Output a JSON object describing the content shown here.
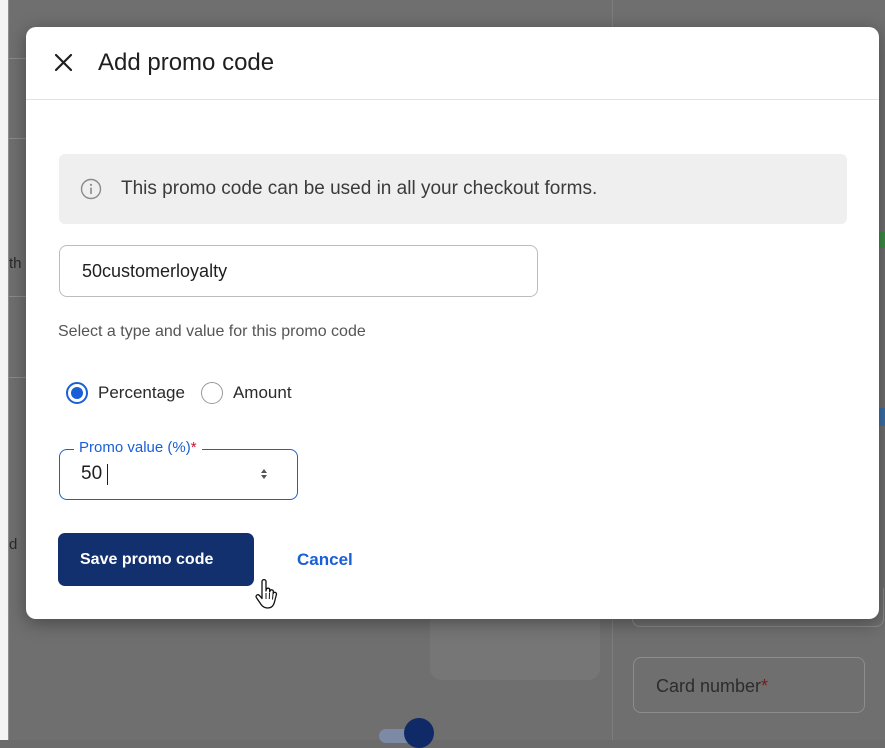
{
  "modal": {
    "title": "Add promo code",
    "info_text": "This promo code can be used in all your checkout forms.",
    "code_input": {
      "value": "50customerloyalty",
      "placeholder": ""
    },
    "helper_text": "Select a type and value for this promo code",
    "type_options": [
      {
        "label": "Percentage",
        "selected": true
      },
      {
        "label": "Amount",
        "selected": false
      }
    ],
    "promo_value": {
      "label": "Promo value (%)",
      "required_mark": "*",
      "value": "50"
    },
    "save_label": "Save promo code",
    "cancel_label": "Cancel"
  },
  "background": {
    "fragment_th": "th",
    "fragment_d": "d",
    "card_number_label": "Card number",
    "card_number_required": "*"
  },
  "icons": {
    "close": "close-icon",
    "info": "info-icon",
    "cursor": "hand-pointer-cursor"
  },
  "colors": {
    "accent": "#1a5fd6",
    "primary_button": "#13306e",
    "required": "#c8102e"
  }
}
